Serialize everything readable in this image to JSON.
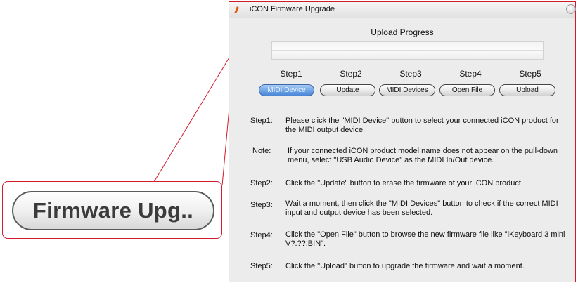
{
  "zoom_callout": {
    "button_label": "Firmware Upg.."
  },
  "window": {
    "title": "iCON Firmware Upgrade",
    "upload_progress_label": "Upload Progress",
    "progress_fraction": 0.0,
    "steps": [
      {
        "label": "Step1",
        "button": "MIDI Device",
        "active": true
      },
      {
        "label": "Step2",
        "button": "Update",
        "active": false
      },
      {
        "label": "Step3",
        "button": "MIDI Devices",
        "active": false
      },
      {
        "label": "Step4",
        "button": "Open File",
        "active": false
      },
      {
        "label": "Step5",
        "button": "Upload",
        "active": false
      }
    ],
    "instructions": [
      {
        "label": "Step1:",
        "text": "Please click the \"MIDI Device\" button to select your connected iCON product for the MIDI output device."
      },
      {
        "label": "Note:",
        "text": "If your connected iCON product model name does not appear on the pull-down menu, select \"USB Audio Device\" as the MIDI In/Out device."
      },
      {
        "label": "Step2:",
        "text": "Click the \"Update\" button to  erase  the firmware of your iCON product."
      },
      {
        "label": "Step3:",
        "text": "Wait a moment, then click the \"MIDI Devices\" button to check if  the correct MIDI input and output  device has been selected."
      },
      {
        "label": "Step4:",
        "text": "Click the \"Open File\" button to browse the new firmware file like \"iKeyboard 3 mini V?.??.BIN\"."
      },
      {
        "label": "Step5:",
        "text": "Click the \"Upload\" button to  upgrade the firmware and wait a moment."
      }
    ]
  },
  "colors": {
    "callout_border": "#d11b2a",
    "active_button": "#6ea4e6"
  }
}
